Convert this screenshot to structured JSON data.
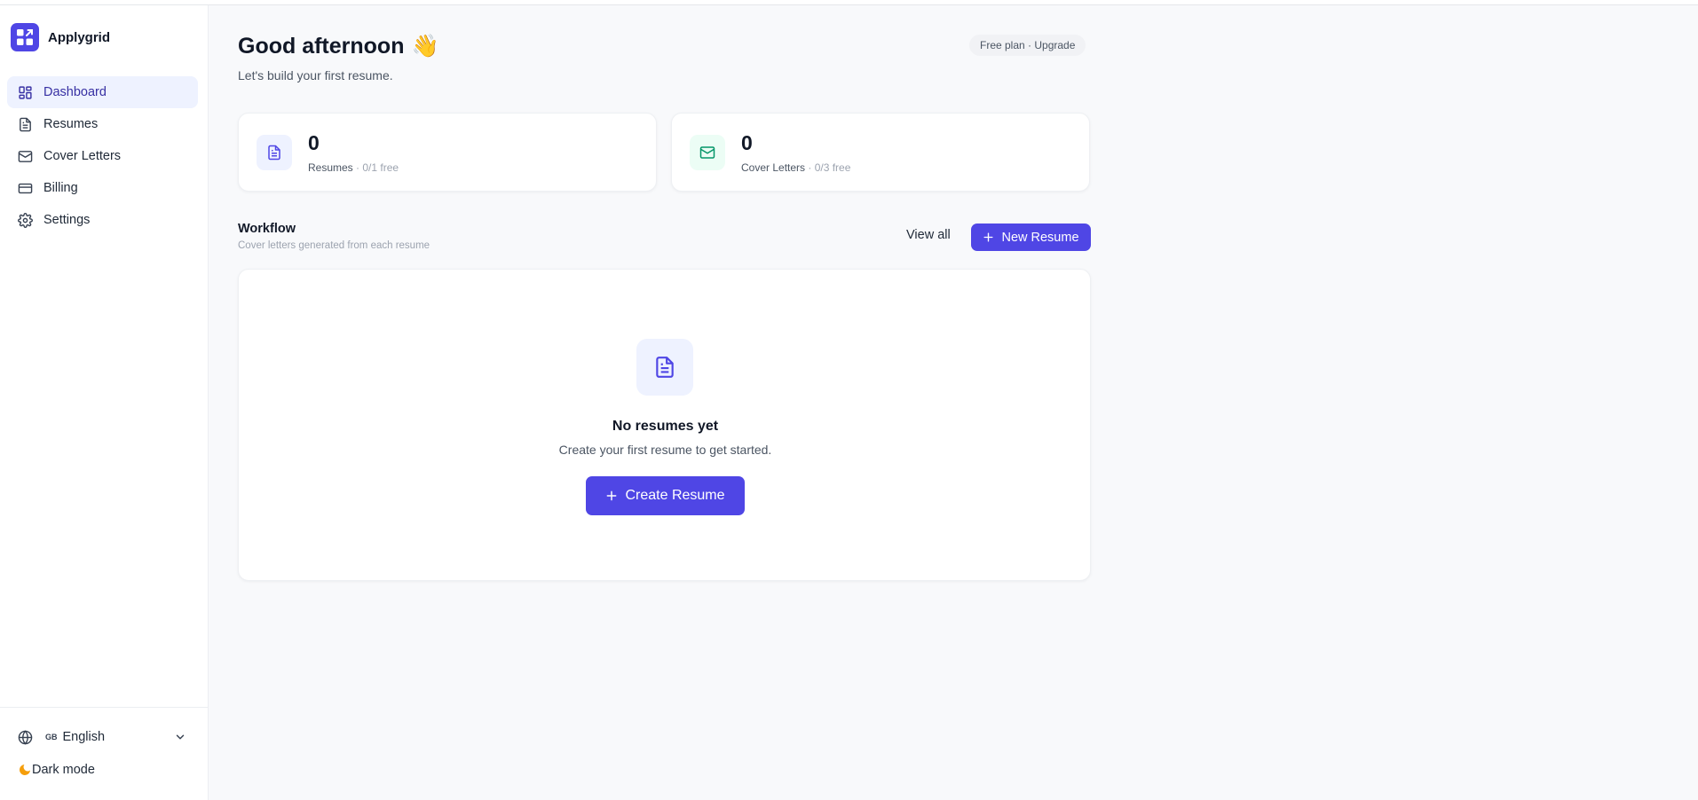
{
  "brand": {
    "name": "Applygrid",
    "accent": "#4f46e5"
  },
  "sidebar": {
    "items": [
      {
        "label": "Dashboard",
        "icon": "dashboard-grid-icon",
        "active": true
      },
      {
        "label": "Resumes",
        "icon": "document-icon",
        "active": false
      },
      {
        "label": "Cover Letters",
        "icon": "mail-icon",
        "active": false
      },
      {
        "label": "Billing",
        "icon": "credit-card-icon",
        "active": false
      },
      {
        "label": "Settings",
        "icon": "gear-icon",
        "active": false
      }
    ],
    "language": {
      "flag": "GB",
      "label": "English"
    },
    "dark_mode_label": "Dark mode"
  },
  "header": {
    "greeting": "Good afternoon",
    "greeting_emoji": "👋",
    "subtitle": "Let's build your first resume.",
    "plan": "Free plan · Upgrade"
  },
  "stats": [
    {
      "value": "0",
      "label": "Resumes",
      "quota": " · 0/1 free",
      "icon": "document-icon"
    },
    {
      "value": "0",
      "label": "Cover Letters",
      "quota": " · 0/3 free",
      "icon": "mail-icon"
    }
  ],
  "workflow": {
    "title": "Workflow",
    "subtitle": "Cover letters generated from each resume",
    "view_all": "View all",
    "new_resume": "New Resume"
  },
  "empty_state": {
    "title": "No resumes yet",
    "subtitle": "Create your first resume to get started.",
    "button": "Create Resume"
  }
}
